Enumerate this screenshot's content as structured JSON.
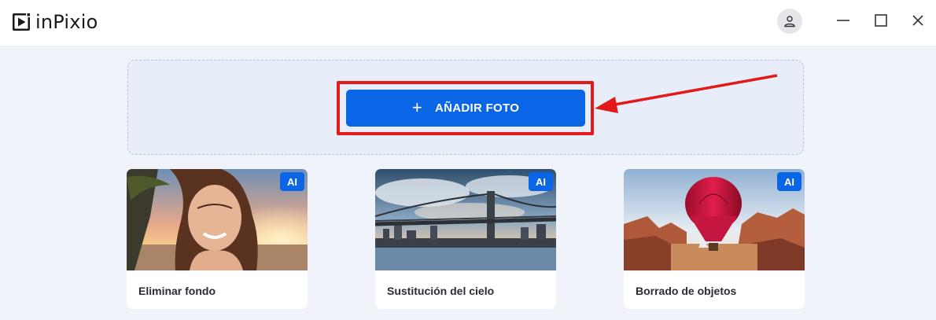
{
  "app": {
    "name": "inPixio"
  },
  "colors": {
    "accent": "#0a66e6",
    "highlight": "#e21a1a",
    "background": "#f0f3f9"
  },
  "titlebar": {
    "icons": [
      "user-icon",
      "minimize-icon",
      "maximize-icon",
      "close-icon"
    ]
  },
  "dropzone": {
    "button_icon": "+",
    "button_label": "AÑADIR FOTO"
  },
  "cards": [
    {
      "label": "Eliminar fondo",
      "badge": "AI",
      "image": "woman-beach-sunset"
    },
    {
      "label": "Sustitución del cielo",
      "badge": "AI",
      "image": "bridge-city-sky"
    },
    {
      "label": "Borrado de objetos",
      "badge": "AI",
      "image": "hot-air-balloon-canyon"
    }
  ]
}
